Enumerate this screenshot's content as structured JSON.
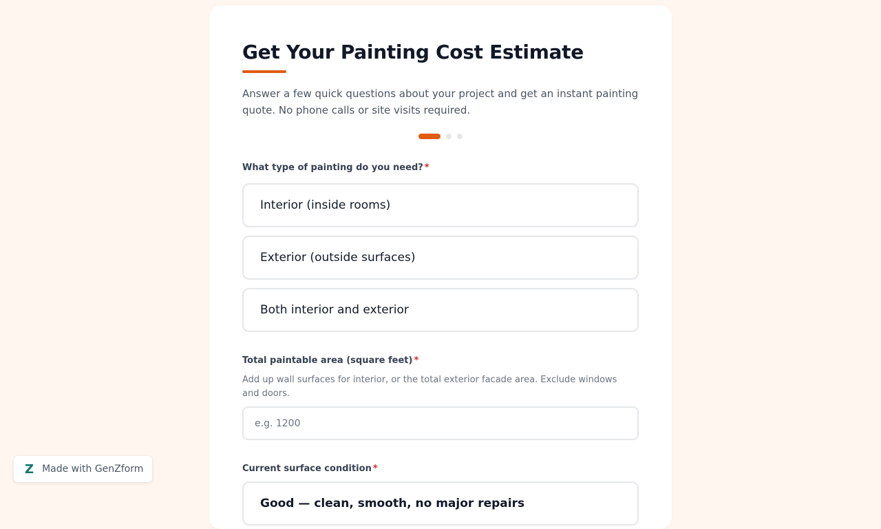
{
  "form": {
    "title": "Get Your Painting Cost Estimate",
    "intro": "Answer a few quick questions about your project and get an instant painting quote. No phone calls or site visits required.",
    "progress": {
      "current_step": 1,
      "total_steps": 3
    },
    "q1": {
      "label": "What type of painting do you need?",
      "required_mark": "*",
      "options": [
        {
          "label": "Interior (inside rooms)"
        },
        {
          "label": "Exterior (outside surfaces)"
        },
        {
          "label": "Both interior and exterior"
        }
      ]
    },
    "q2": {
      "label": "Total paintable area (square feet)",
      "required_mark": "*",
      "help": "Add up wall surfaces for interior, or the total exterior facade area. Exclude windows and doors.",
      "placeholder": "e.g. 1200",
      "value": ""
    },
    "q3": {
      "label": "Current surface condition",
      "required_mark": "*",
      "first_option_partial": "Good — clean, smooth, no major repairs"
    }
  },
  "badge": {
    "logo": "Z",
    "text": "Made with GenZform"
  },
  "colors": {
    "accent": "#e05a12",
    "background": "#fff6f0",
    "required": "#dc2626",
    "badge_logo": "#0f766e"
  }
}
